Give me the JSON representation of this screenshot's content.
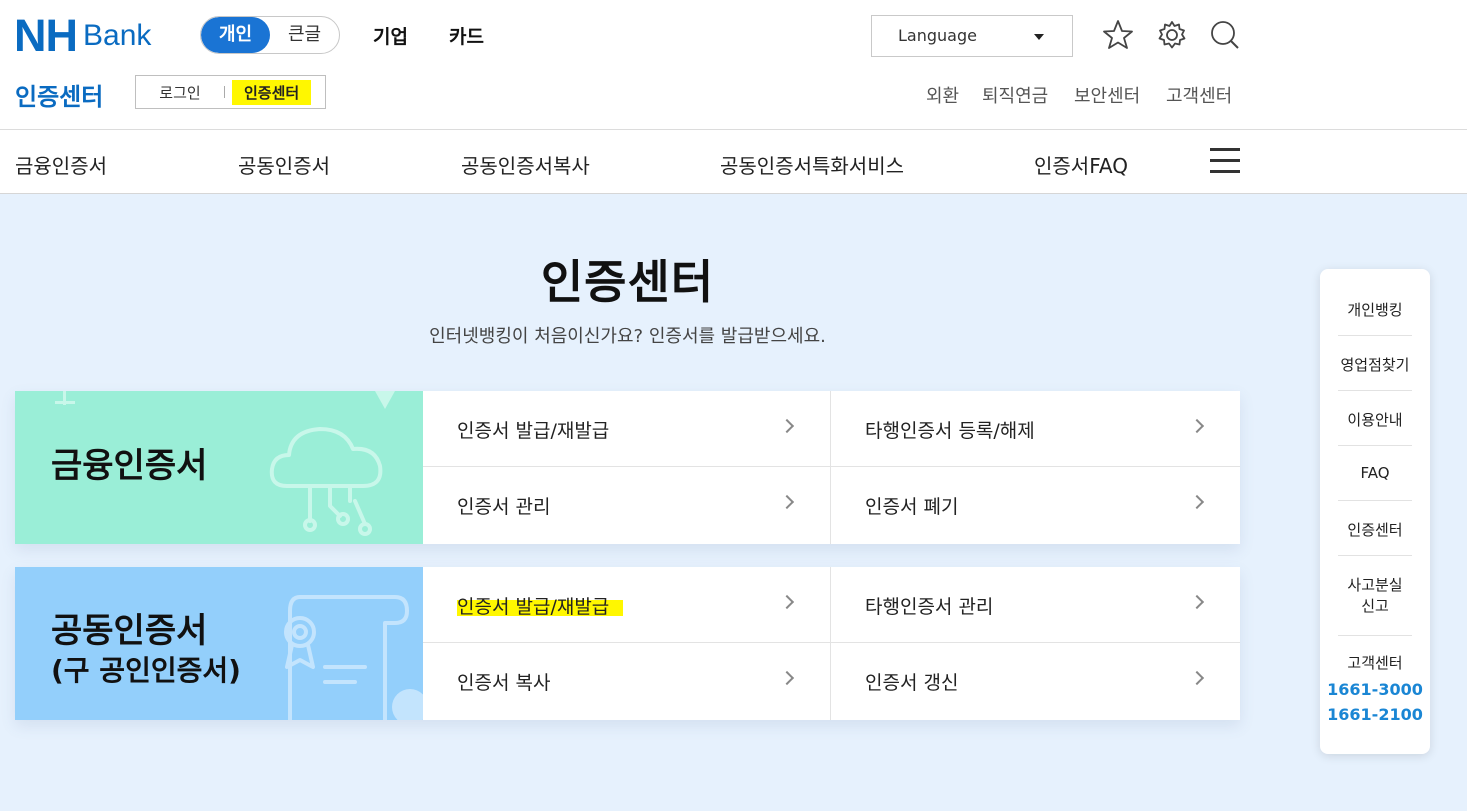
{
  "header": {
    "logo": {
      "nh": "NH",
      "bank": "Bank"
    },
    "mode_toggle": {
      "personal": "개인",
      "large_text": "큰글"
    },
    "top_links": [
      "기업",
      "카드"
    ],
    "language": {
      "label": "Language"
    },
    "icons": [
      "star-icon",
      "gear-icon",
      "search-icon"
    ],
    "sub_title": "인증센터",
    "sub_nav": {
      "login": "로그인",
      "cert_center": "인증센터"
    },
    "util_links": [
      "외환",
      "퇴직연금",
      "보안센터",
      "고객센터"
    ]
  },
  "gnb": {
    "items": [
      "금융인증서",
      "공동인증서",
      "공동인증서복사",
      "공동인증서특화서비스",
      "인증서FAQ"
    ]
  },
  "main": {
    "title": "인증센터",
    "desc": "인터넷뱅킹이 처음이신가요? 인증서를 발급받으세요.",
    "cards": [
      {
        "title": "금융인증서",
        "subtitle": "",
        "links": [
          "인증서 발급/재발급",
          "타행인증서 등록/해제",
          "인증서 관리",
          "인증서 폐기"
        ]
      },
      {
        "title": "공동인증서",
        "subtitle": "(구 공인인증서)",
        "links": [
          "인증서 발급/재발급",
          "타행인증서 관리",
          "인증서 복사",
          "인증서 갱신"
        ]
      }
    ]
  },
  "quick_menu": {
    "items": [
      "개인뱅킹",
      "영업점찾기",
      "이용안내",
      "FAQ",
      "인증센터"
    ],
    "report_line1": "사고분실",
    "report_line2": "신고",
    "support_title": "고객센터",
    "phones": [
      "1661-3000",
      "1661-2100"
    ]
  },
  "colors": {
    "brand_blue": "#0a6bc1",
    "toggle_active": "#1a74d4",
    "highlight": "#fff700",
    "page_bg": "#e6f1fd",
    "card_financial": "#9aeed7",
    "card_joint": "#93cffb",
    "phone": "#1a86d4"
  }
}
